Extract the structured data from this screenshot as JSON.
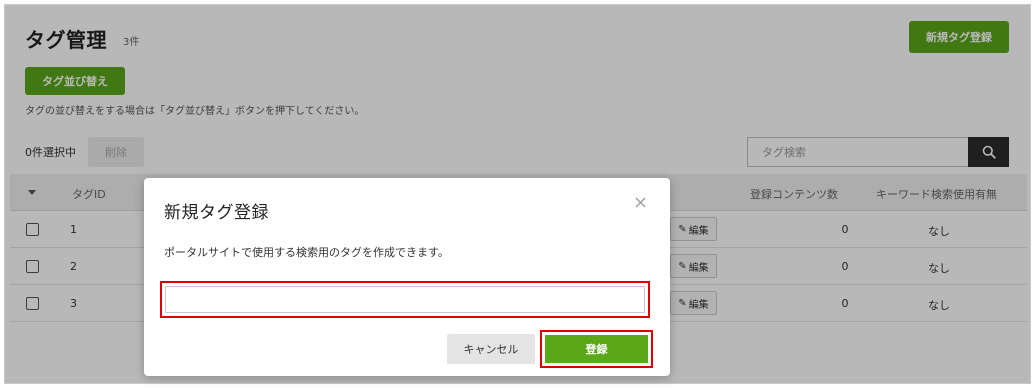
{
  "page": {
    "title": "タグ管理",
    "count": "3件",
    "new_tag_button": "新規タグ登録",
    "sort_button": "タグ並び替え",
    "sort_hint": "タグの並び替えをする場合は「タグ並び替え」ボタンを押下してください。",
    "selected_count": "0件選択中",
    "delete_button": "削除",
    "search": {
      "placeholder": "タグ検索",
      "value": ""
    }
  },
  "table": {
    "columns": {
      "tag_id": "タグID",
      "content_count": "登録コンテンツ数",
      "keyword_usage": "キーワード検索使用有無"
    },
    "edit_label": "編集",
    "rows": [
      {
        "id": "1",
        "content_count": "0",
        "keyword_usage": "なし"
      },
      {
        "id": "2",
        "content_count": "0",
        "keyword_usage": "なし"
      },
      {
        "id": "3",
        "content_count": "0",
        "keyword_usage": "なし"
      }
    ]
  },
  "modal": {
    "title": "新規タグ登録",
    "description": "ポータルサイトで使用する検索用のタグを作成できます。",
    "input_value": "",
    "input_placeholder": "",
    "cancel_button": "キャンセル",
    "register_button": "登録"
  },
  "colors": {
    "accent_green": "#5aa718",
    "highlight_red": "#e00000",
    "dark_button": "#2b2b2b"
  },
  "icons": {
    "close": "close-icon",
    "search": "search-icon",
    "edit": "pencil-icon",
    "sort_caret": "caret-down-icon"
  }
}
